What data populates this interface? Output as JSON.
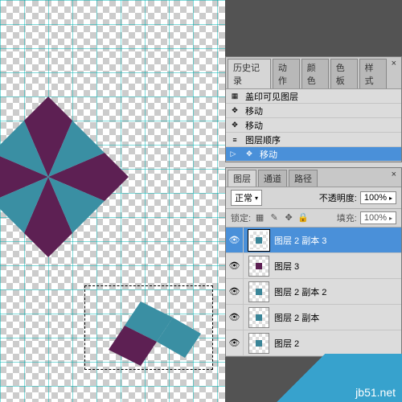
{
  "history_panel": {
    "tabs": [
      "历史记录",
      "动作",
      "颜色",
      "色板",
      "样式"
    ],
    "active_tab": 0,
    "items": [
      {
        "icon": "merge-visible-icon",
        "label": "盖印可见图层"
      },
      {
        "icon": "move-icon",
        "label": "移动"
      },
      {
        "icon": "move-icon",
        "label": "移动"
      },
      {
        "icon": "layer-order-icon",
        "label": "图层顺序"
      },
      {
        "icon": "move-icon",
        "label": "移动"
      }
    ],
    "selected": 4
  },
  "layers_panel": {
    "tabs": [
      "图层",
      "通道",
      "路径"
    ],
    "active_tab": 0,
    "blend_mode": "正常",
    "opacity_label": "不透明度:",
    "opacity_value": "100%",
    "lock_label": "锁定:",
    "fill_label": "填充:",
    "fill_value": "100%",
    "layers": [
      {
        "name": "图层 2 副本 3",
        "visible": true
      },
      {
        "name": "图层 3",
        "visible": true
      },
      {
        "name": "图层 2 副本 2",
        "visible": true
      },
      {
        "name": "图层 2 副本",
        "visible": true
      },
      {
        "name": "图层 2",
        "visible": true
      }
    ],
    "selected": 0
  },
  "colors": {
    "purple": "#5d2053",
    "teal": "#3a8fa3",
    "selection": "#4a90d9"
  },
  "watermark": "jb51.net"
}
